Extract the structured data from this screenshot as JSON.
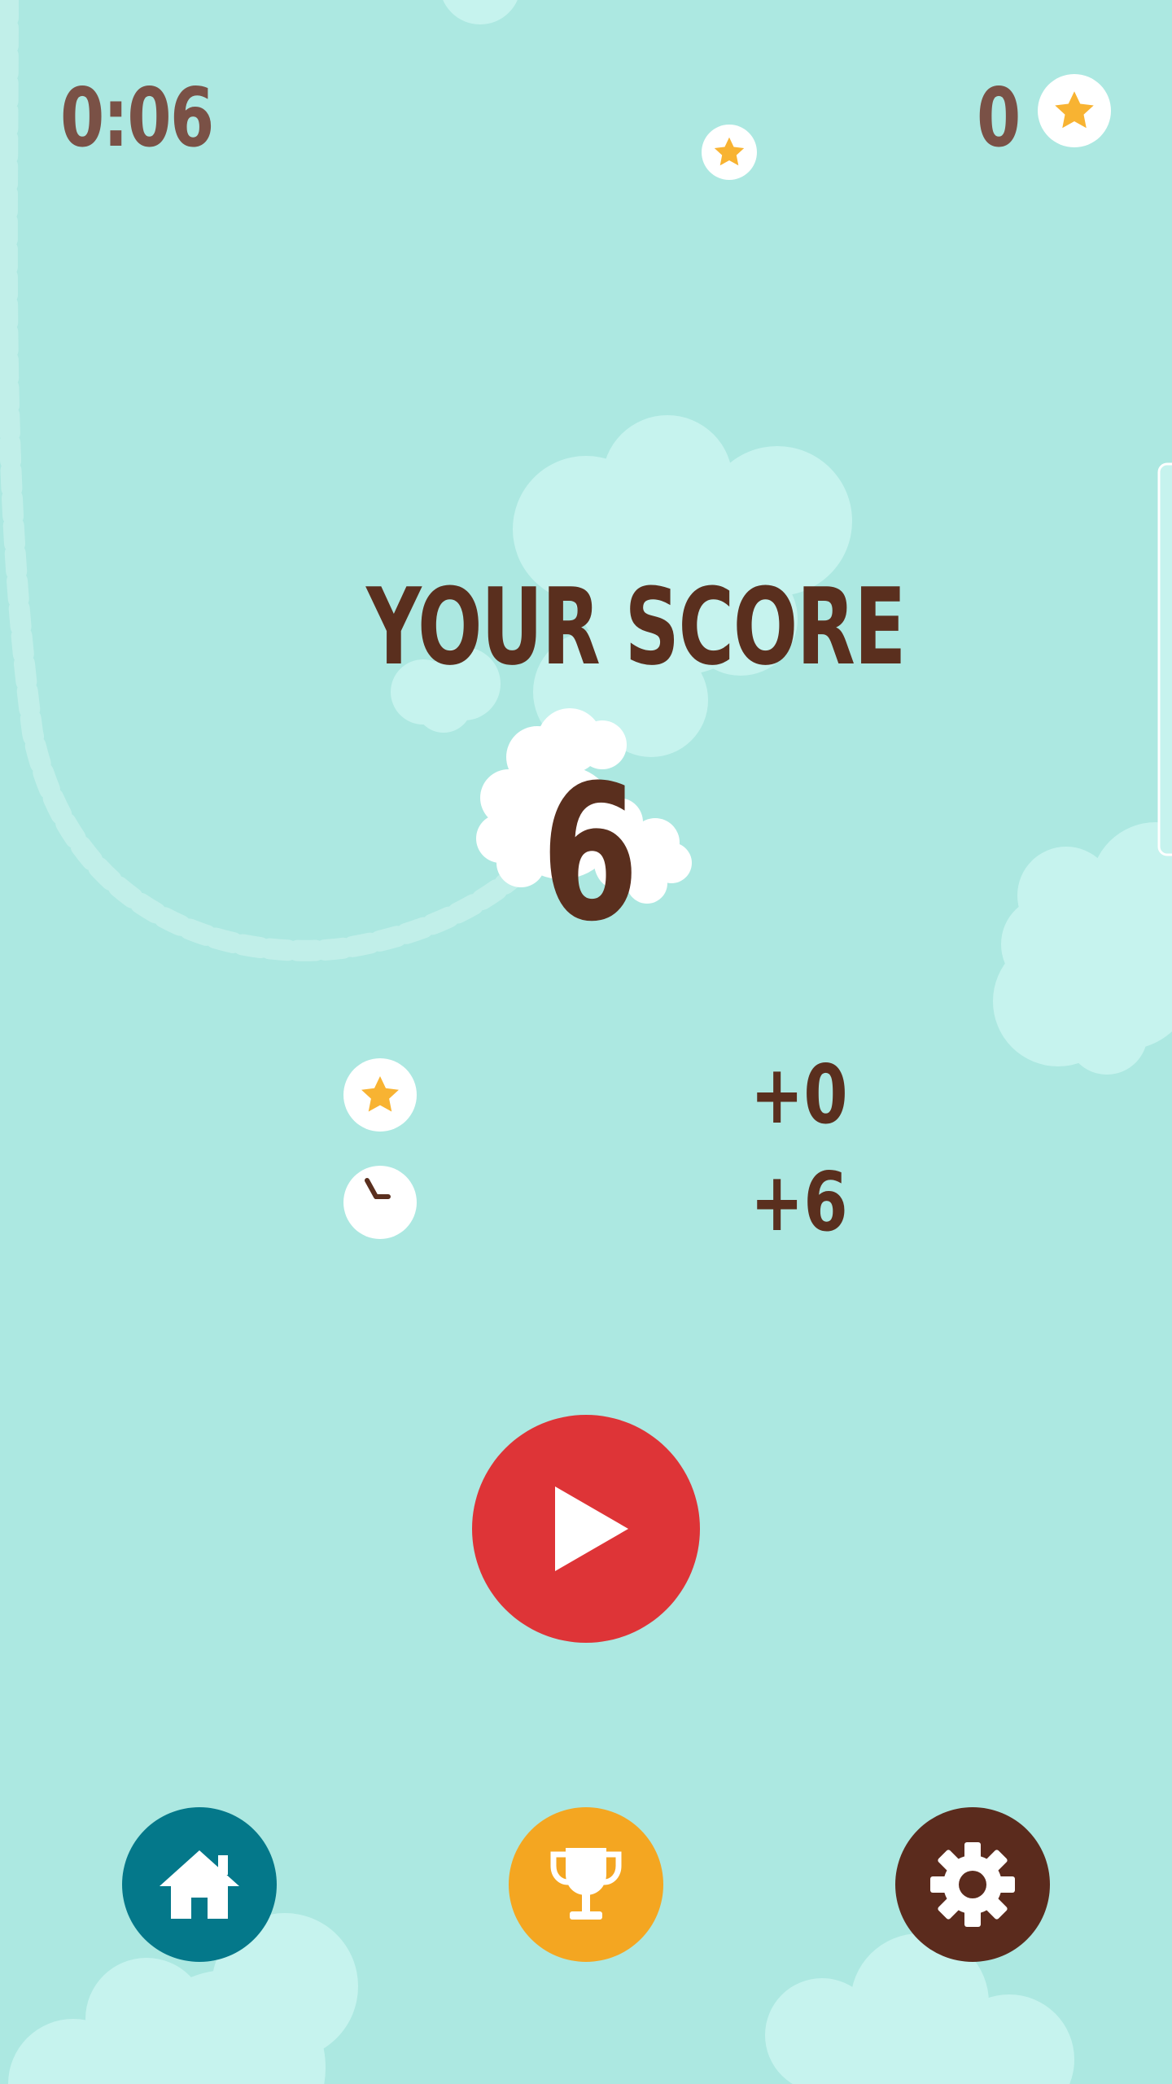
{
  "hud": {
    "timer": "0:06",
    "star_count": "0"
  },
  "result": {
    "title": "YOUR SCORE",
    "score": "6"
  },
  "breakdown": [
    {
      "icon": "star-icon",
      "value": "+0"
    },
    {
      "icon": "clock-icon",
      "value": "+6"
    }
  ],
  "buttons": {
    "play": {
      "icon": "play-icon",
      "color": "#de3437"
    },
    "home": {
      "icon": "home-icon",
      "color": "#04788a"
    },
    "leaderboard": {
      "icon": "trophy-icon",
      "color": "#f4a621"
    },
    "settings": {
      "icon": "gear-icon",
      "color": "#5b2b1d"
    }
  },
  "colors": {
    "background": "#ace8e1",
    "cloud": "#c6f3ee",
    "text_dark": "#5a2f1e",
    "hud_text": "#7a5146",
    "star": "#f8b332"
  }
}
